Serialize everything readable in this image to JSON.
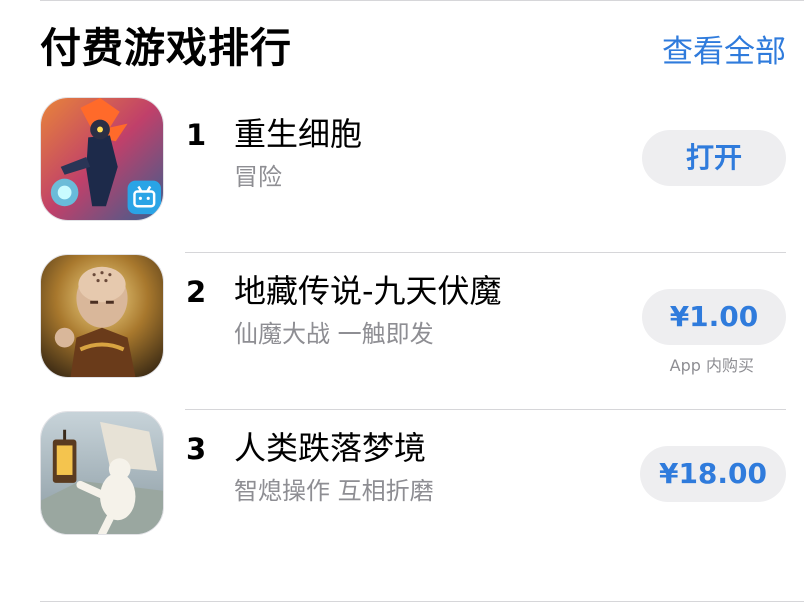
{
  "section": {
    "title": "付费游戏排行",
    "see_all": "查看全部"
  },
  "apps": [
    {
      "rank": "1",
      "name": "重生细胞",
      "subtitle": "冒险",
      "button": "打开",
      "icon": "dead-cells-app-icon"
    },
    {
      "rank": "2",
      "name": "地藏传说-九天伏魔",
      "subtitle": "仙魔大战 一触即发",
      "button": "¥1.00",
      "note": "App 内购买",
      "icon": "dizang-legend-app-icon"
    },
    {
      "rank": "3",
      "name": "人类跌落梦境",
      "subtitle": "智熄操作 互相折磨",
      "button": "¥18.00",
      "icon": "human-fall-flat-app-icon"
    }
  ],
  "colors": {
    "accent": "#2f7bdc",
    "button_bg": "#eeeef0",
    "secondary_text": "#8e8e93",
    "divider": "#d6d6d9"
  }
}
